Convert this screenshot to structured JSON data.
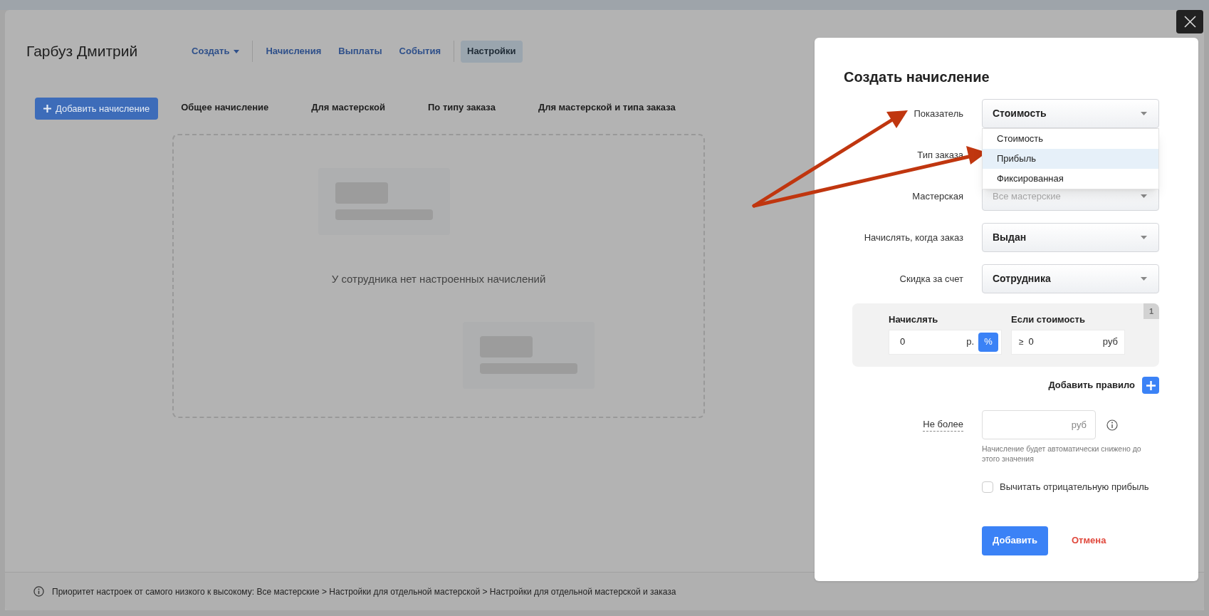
{
  "employee_name": "Гарбуз Дмитрий",
  "nav_groups": [
    [
      {
        "label": "Создать",
        "kind": "dropdown",
        "selected": false
      }
    ],
    [
      {
        "label": "Начисления",
        "kind": "link",
        "selected": false
      },
      {
        "label": "Выплаты",
        "kind": "link",
        "selected": false
      },
      {
        "label": "События",
        "kind": "link",
        "selected": false
      }
    ],
    [
      {
        "label": "Настройки",
        "kind": "link",
        "selected": true
      }
    ]
  ],
  "add_button": "Добавить начисление",
  "accrual_tabs": [
    {
      "label": "Общее начисление",
      "selected": false
    },
    {
      "label": "Для мастерской",
      "selected": false
    },
    {
      "label": "По типу заказа",
      "selected": false
    },
    {
      "label": "Для мастерской и типа заказа",
      "selected": false
    }
  ],
  "empty_state": {
    "message": "У сотрудника нет настроенных начислений"
  },
  "footer_note": "Приоритет настроек от самого низкого к высокому: Все мастерские > Настройки для отдельной мастерской > Настройки для отдельной мастерской и заказа",
  "modal": {
    "title": "Создать начисление",
    "fields": [
      {
        "label": "Показатель",
        "kind": "select",
        "value": "Стоимость",
        "options": [
          {
            "label": "Стоимость",
            "highlighted": false
          },
          {
            "label": "Прибыль",
            "highlighted": true
          },
          {
            "label": "Фиксированная",
            "highlighted": false
          }
        ]
      },
      {
        "label": "Тип заказа",
        "kind": "covered"
      },
      {
        "label": "Мастерская",
        "kind": "select",
        "placeholder": "Все мастерские"
      },
      {
        "label": "Начислять, когда заказ",
        "kind": "select",
        "value": "Выдан"
      },
      {
        "label": "Скидка за счет",
        "kind": "select",
        "value": "Сотрудника"
      }
    ],
    "rule": {
      "number": "1",
      "accrue_label": "Начислять",
      "accrue_value": "0",
      "units": [
        {
          "label": "р.",
          "selected": false
        },
        {
          "label": "%",
          "selected": true
        }
      ],
      "condition_label": "Если стоимость",
      "condition_sign": "≥",
      "condition_value": "0",
      "condition_unit": "руб"
    },
    "add_rule": "Добавить правило",
    "limit": {
      "label": "Не более",
      "unit": "руб",
      "hint": "Начисление будет автоматически снижено до этого значения"
    },
    "checkbox": {
      "label": "Вычитать отрицательную прибыль",
      "checked": false
    },
    "submit": "Добавить",
    "cancel": "Отмена"
  }
}
